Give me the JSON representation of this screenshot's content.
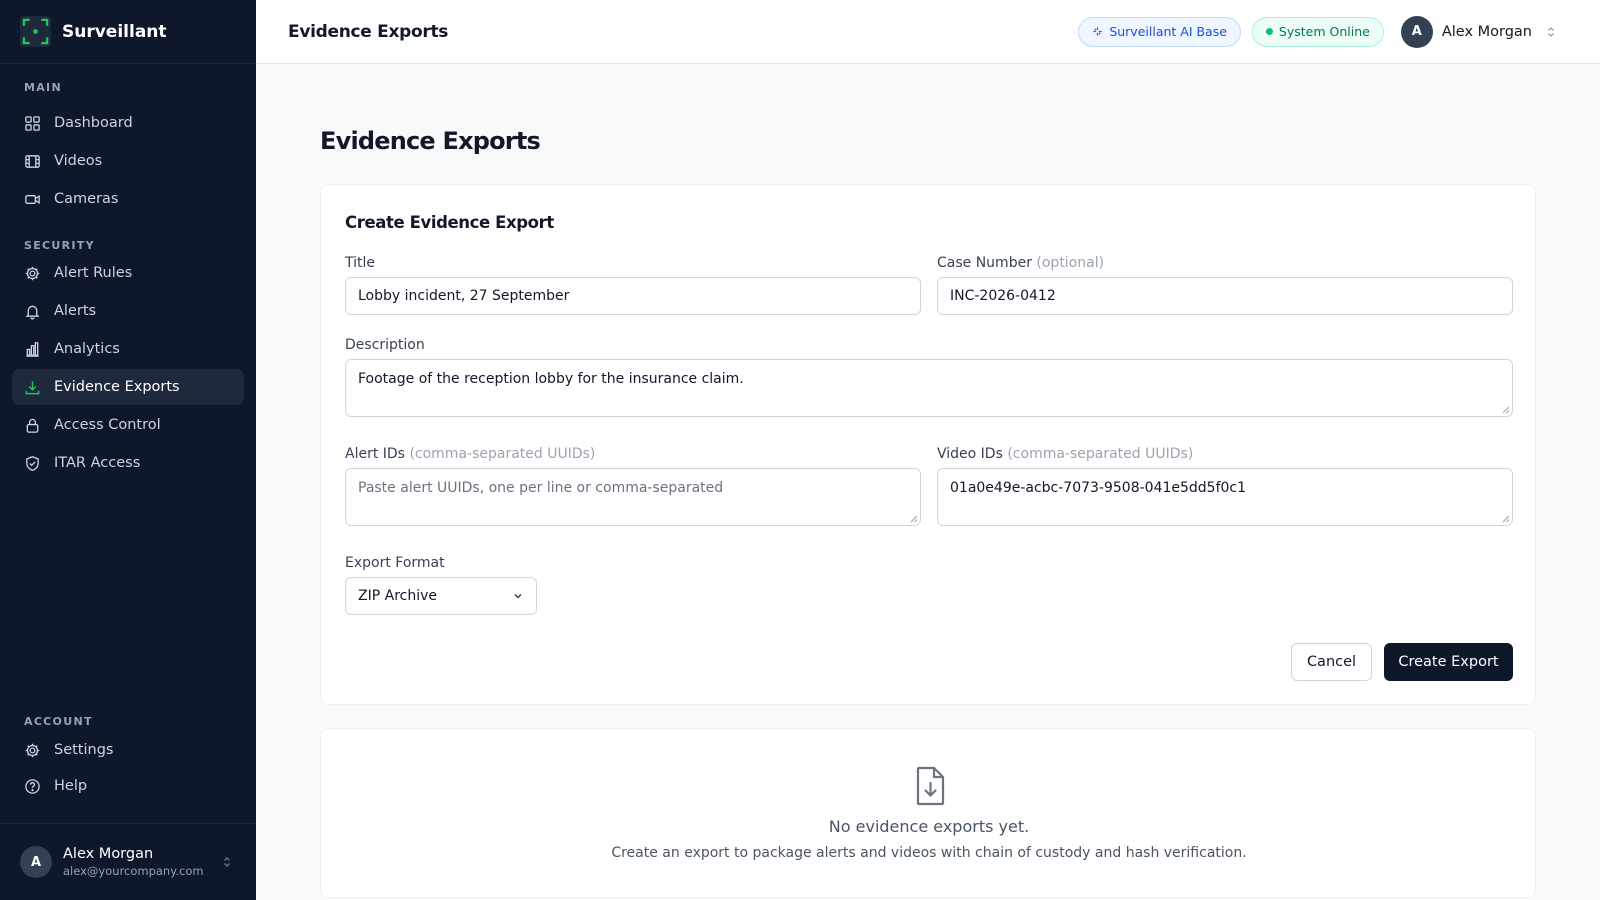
{
  "app": {
    "name": "Surveillant"
  },
  "sidebar": {
    "sections": [
      {
        "label": "MAIN",
        "items": [
          {
            "label": "Dashboard",
            "icon": "grid-icon"
          },
          {
            "label": "Videos",
            "icon": "film-icon"
          },
          {
            "label": "Cameras",
            "icon": "camera-icon"
          }
        ]
      },
      {
        "label": "SECURITY",
        "items": [
          {
            "label": "Alert Rules",
            "icon": "gear-icon"
          },
          {
            "label": "Alerts",
            "icon": "bell-icon"
          },
          {
            "label": "Analytics",
            "icon": "bar-chart-icon"
          },
          {
            "label": "Evidence Exports",
            "icon": "download-icon",
            "active": true
          },
          {
            "label": "Access Control",
            "icon": "lock-icon"
          },
          {
            "label": "ITAR Access",
            "icon": "shield-check-icon"
          }
        ]
      },
      {
        "label": "ACCOUNT",
        "items": [
          {
            "label": "Settings",
            "icon": "gear-icon"
          },
          {
            "label": "Help",
            "icon": "help-circle-icon"
          }
        ]
      }
    ],
    "user": {
      "initial": "A",
      "name": "Alex Morgan",
      "email": "alex@yourcompany.com"
    }
  },
  "header": {
    "title": "Evidence Exports",
    "ai_badge": "Surveillant AI Base",
    "status_badge": "System Online",
    "user_initial": "A",
    "user_name": "Alex Morgan"
  },
  "page": {
    "title": "Evidence Exports"
  },
  "form": {
    "title": "Create Evidence Export",
    "title_label": "Title",
    "title_value": "Lobby incident, 27 September",
    "case_label": "Case Number",
    "case_hint": "(optional)",
    "case_value": "INC-2026-0412",
    "description_label": "Description",
    "description_value": "Footage of the reception lobby for the insurance claim.",
    "alert_ids_label": "Alert IDs",
    "alert_ids_hint": "(comma-separated UUIDs)",
    "alert_ids_placeholder": "Paste alert UUIDs, one per line or comma-separated",
    "video_ids_label": "Video IDs",
    "video_ids_hint": "(comma-separated UUIDs)",
    "video_ids_value": "01a0e49e-acbc-7073-9508-041e5dd5f0c1",
    "format_label": "Export Format",
    "format_value": "ZIP Archive",
    "cancel_label": "Cancel",
    "submit_label": "Create Export"
  },
  "empty_state": {
    "title": "No evidence exports yet.",
    "subtitle": "Create an export to package alerts and videos with chain of custody and hash verification."
  },
  "colors": {
    "sidebar_bg": "#0f172a",
    "accent_green": "#22c55e",
    "primary_button": "#0f172a"
  }
}
